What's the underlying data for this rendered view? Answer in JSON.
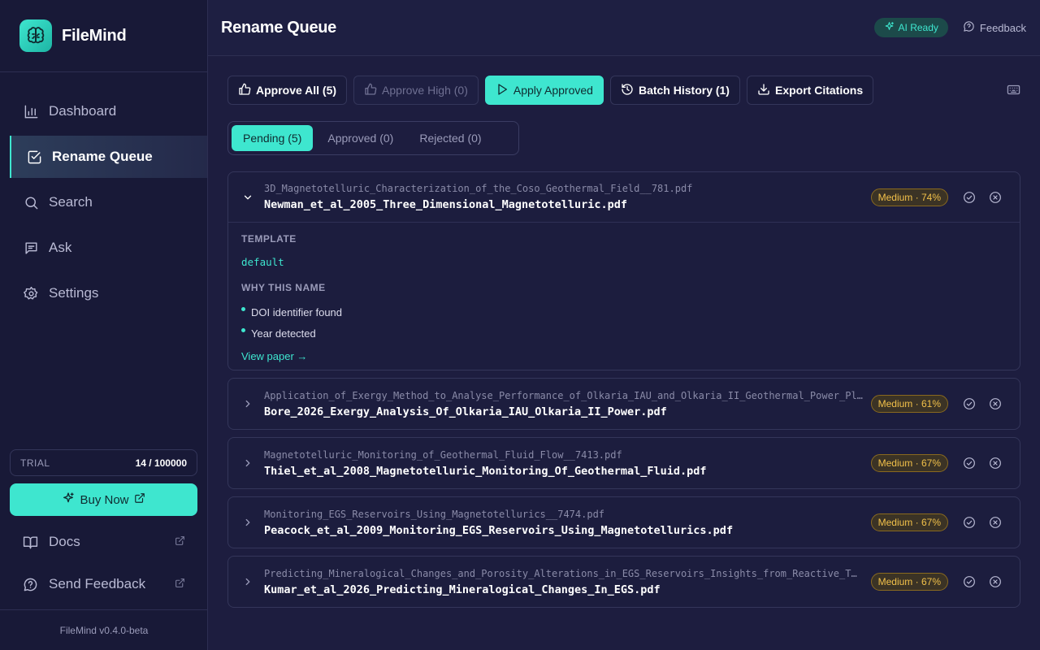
{
  "app": {
    "name": "FileMind",
    "version": "FileMind v0.4.0-beta"
  },
  "sidebar": {
    "nav": [
      {
        "label": "Dashboard",
        "icon": "chart-icon"
      },
      {
        "label": "Rename Queue",
        "icon": "checkbox-icon",
        "active": true
      },
      {
        "label": "Search",
        "icon": "search-icon"
      },
      {
        "label": "Ask",
        "icon": "chat-icon"
      },
      {
        "label": "Settings",
        "icon": "gear-icon"
      }
    ],
    "trial_label": "TRIAL",
    "trial_count": "14 / 100000",
    "buy_label": "Buy Now",
    "docs_label": "Docs",
    "send_feedback_label": "Send Feedback"
  },
  "header": {
    "title": "Rename Queue",
    "ai_status": "AI Ready",
    "feedback_label": "Feedback"
  },
  "toolbar": {
    "approve_all": "Approve All (5)",
    "approve_high": "Approve High (0)",
    "apply_approved": "Apply Approved",
    "batch_history": "Batch History (1)",
    "export_citations": "Export Citations"
  },
  "tabs": [
    {
      "label": "Pending (5)",
      "active": true
    },
    {
      "label": "Approved (0)"
    },
    {
      "label": "Rejected (0)"
    }
  ],
  "queue": [
    {
      "original": "3D_Magnetotelluric_Characterization_of_the_Coso_Geothermal_Field__781.pdf",
      "new_name": "Newman_et_al_2005_Three_Dimensional_Magnetotelluric.pdf",
      "confidence": "Medium · 74%",
      "expanded": true,
      "template_label": "TEMPLATE",
      "template": "default",
      "why_label": "WHY THIS NAME",
      "reasons": [
        "DOI identifier found",
        "Year detected"
      ],
      "view_paper": "View paper →"
    },
    {
      "original": "Application_of_Exergy_Method_to_Analyse_Performance_of_Olkaria_IAU_and_Olkaria_II_Geothermal_Power_Pl…",
      "new_name": "Bore_2026_Exergy_Analysis_Of_Olkaria_IAU_Olkaria_II_Power.pdf",
      "confidence": "Medium · 61%"
    },
    {
      "original": "Magnetotelluric_Monitoring_of_Geothermal_Fluid_Flow__7413.pdf",
      "new_name": "Thiel_et_al_2008_Magnetotelluric_Monitoring_Of_Geothermal_Fluid.pdf",
      "confidence": "Medium · 67%"
    },
    {
      "original": "Monitoring_EGS_Reservoirs_Using_Magnetotellurics__7474.pdf",
      "new_name": "Peacock_et_al_2009_Monitoring_EGS_Reservoirs_Using_Magnetotellurics.pdf",
      "confidence": "Medium · 67%"
    },
    {
      "original": "Predicting_Mineralogical_Changes_and_Porosity_Alterations_in_EGS_Reservoirs_Insights_from_Reactive_T…",
      "new_name": "Kumar_et_al_2026_Predicting_Mineralogical_Changes_In_EGS.pdf",
      "confidence": "Medium · 67%"
    }
  ],
  "colors": {
    "accent": "#3ee6cf",
    "background": "#1d1d3f",
    "sidebar": "#181937",
    "confidence_medium": "#f2c14a"
  }
}
